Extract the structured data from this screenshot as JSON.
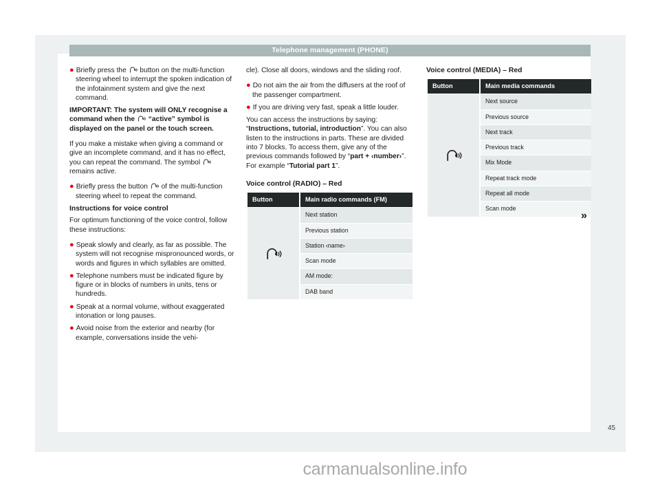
{
  "header": {
    "title": "Telephone management (PHONE)"
  },
  "page_number": "45",
  "watermark": "carmanualsonline.info",
  "continuation_arrow": "»",
  "icons": {
    "voice_control": "voice-control-icon"
  },
  "colors": {
    "header_bar": "#a8b7b7",
    "bullet_red": "#e3001b",
    "table_header": "#232829",
    "row_shade_a": "#e3e8e9",
    "row_shade_b": "#f2f5f5",
    "button_cell": "#e9eded",
    "page_bg": "#edf1f1"
  },
  "left_column": {
    "blocks": [
      {
        "type": "bullet",
        "runs": [
          {
            "text": "Briefly press the ",
            "style": "normal"
          },
          {
            "text": "",
            "style": "icon"
          },
          {
            "text": " button on the multi-function steering wheel to interrupt the spoken indication of the infotainment system and give the next command.",
            "style": "normal"
          }
        ]
      },
      {
        "type": "paragraph",
        "runs": [
          {
            "text": "IMPORTANT: The system will ONLY recognise a command when the ",
            "style": "bold"
          },
          {
            "text": "",
            "style": "icon"
          },
          {
            "text": " “active” symbol is displayed on the panel or the touch screen.",
            "style": "bold"
          }
        ]
      },
      {
        "type": "paragraph",
        "runs": [
          {
            "text": "If you make a mistake when giving a command or give an incomplete command, and it has no effect, you can repeat the command. The symbol ",
            "style": "normal"
          },
          {
            "text": "",
            "style": "icon"
          },
          {
            "text": " remains active.",
            "style": "normal"
          }
        ]
      },
      {
        "type": "bullet",
        "runs": [
          {
            "text": "Briefly press the button ",
            "style": "normal"
          },
          {
            "text": "",
            "style": "icon"
          },
          {
            "text": " of the multi-function steering wheel to repeat the command.",
            "style": "normal"
          }
        ]
      },
      {
        "type": "subhead",
        "text": "Instructions for voice control"
      },
      {
        "type": "paragraph",
        "runs": [
          {
            "text": "For optimum functioning of the voice control, follow these instructions:",
            "style": "normal"
          }
        ]
      },
      {
        "type": "bullet",
        "runs": [
          {
            "text": "Speak slowly and clearly, as far as possible. The system will not recognise mispronounced words, or words and figures in which syllables are omitted.",
            "style": "normal"
          }
        ]
      },
      {
        "type": "bullet",
        "runs": [
          {
            "text": "Telephone numbers must be indicated figure by figure or in blocks of numbers in units, tens or hundreds.",
            "style": "normal"
          }
        ]
      },
      {
        "type": "bullet",
        "runs": [
          {
            "text": "Speak at a normal volume, without exaggerated intonation or long pauses.",
            "style": "normal"
          }
        ]
      },
      {
        "type": "bullet",
        "runs": [
          {
            "text": "Avoid noise from the exterior and nearby (for example, conversations inside the vehi-",
            "style": "normal"
          }
        ]
      }
    ]
  },
  "middle_column": {
    "blocks": [
      {
        "type": "paragraph",
        "runs": [
          {
            "text": "cle). Close all doors, windows and the sliding roof.",
            "style": "normal"
          }
        ]
      },
      {
        "type": "bullet",
        "runs": [
          {
            "text": "Do not aim the air from the diffusers at the roof of the passenger compartment.",
            "style": "normal"
          }
        ]
      },
      {
        "type": "bullet",
        "runs": [
          {
            "text": "If you are driving very fast, speak a little louder.",
            "style": "normal"
          }
        ]
      },
      {
        "type": "paragraph",
        "runs": [
          {
            "text": "You can access the instructions by saying: “",
            "style": "normal"
          },
          {
            "text": "Instructions, tutorial, introduction",
            "style": "bold"
          },
          {
            "text": "”. You can also listen to the instructions in parts. These are divided into 7 blocks. To access them, give any of the previous commands followed by “",
            "style": "normal"
          },
          {
            "text": "part + ‹number›",
            "style": "bold"
          },
          {
            "text": "”. For example “",
            "style": "normal"
          },
          {
            "text": "Tutorial part 1",
            "style": "bold"
          },
          {
            "text": "”.",
            "style": "normal"
          }
        ]
      }
    ],
    "table": {
      "caption": "Voice control (RADIO) – Red",
      "columns": [
        "Button",
        "Main radio commands (FM)"
      ],
      "button_icon": "voice-control-icon",
      "rows": [
        "Next station",
        "Previous station",
        "Station ‹name›",
        "Scan mode",
        "AM mode:",
        "DAB band"
      ]
    }
  },
  "right_column": {
    "table": {
      "caption": "Voice control (MEDIA) – Red",
      "columns": [
        "Button",
        "Main media commands"
      ],
      "button_icon": "voice-control-icon",
      "rows": [
        "Next source",
        "Previous source",
        "Next track",
        "Previous track",
        "Mix Mode",
        "Repeat track mode",
        "Repeat all mode",
        "Scan mode"
      ]
    }
  }
}
